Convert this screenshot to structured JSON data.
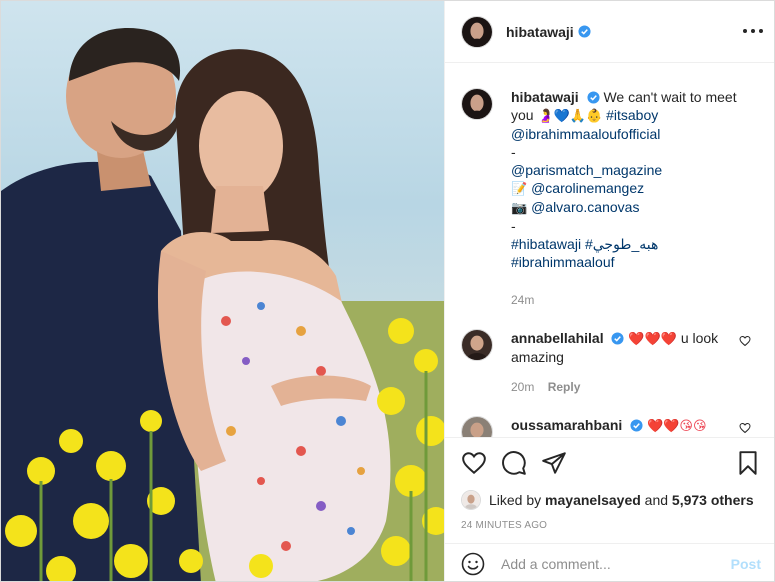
{
  "post": {
    "image_alt": "Couple in a yellow flower field",
    "author": "hibatawaji",
    "more_icon": "more-horizontal-icon"
  },
  "caption": {
    "username": "hibatawaji",
    "text_intro": "We can't wait to meet you",
    "emojis": "🤰💙🙏👶",
    "hashtag_1": "#itsaboy",
    "mention_1": "@ibrahimmaaloufofficial",
    "dash_1": "-",
    "mention_2": "@parismatch_magazine",
    "memo_emoji": "📝",
    "mention_3": "@carolinemangez",
    "camera_emoji": "📷",
    "mention_4": "@alvaro.canovas",
    "dash_2": "-",
    "hashtag_2": "#hibatawaji",
    "hashtag_3": "#هبه_طوجي",
    "hashtag_4": "#ibrahimmaalouf",
    "time": "24m"
  },
  "comments": [
    {
      "username": "annabellahilal",
      "emojis": "❤️❤️❤️",
      "text": "u look amazing",
      "time": "20m",
      "reply_label": "Reply"
    },
    {
      "username": "oussamarahbani",
      "emojis": "❤️❤️😘😘"
    }
  ],
  "likes": {
    "prefix": "Liked by",
    "user": "mayanelsayed",
    "and": "and",
    "count": "5,973 others"
  },
  "timestamp": "24 MINUTES AGO",
  "add_comment": {
    "placeholder": "Add a comment...",
    "post_label": "Post"
  },
  "colors": {
    "link": "#00376b",
    "verified": "#3897f0",
    "muted": "#8e8e8e",
    "post_disabled": "#b2dffc"
  }
}
